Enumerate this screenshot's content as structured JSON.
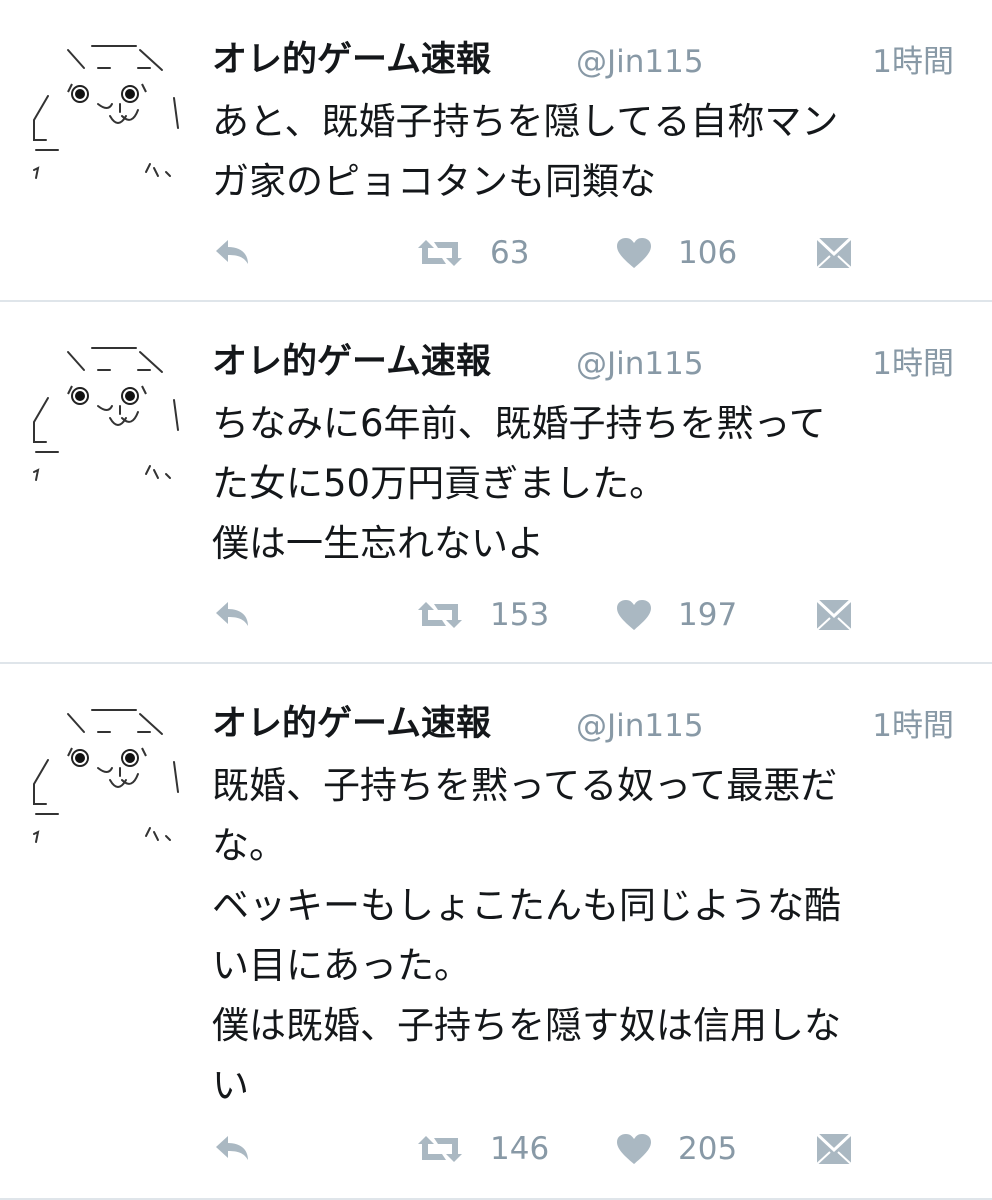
{
  "colors": {
    "text": "#14171a",
    "secondary": "#8899a6",
    "icon": "#aab8c2",
    "divider": "#dfe5ea"
  },
  "tweets": [
    {
      "display_name": "オレ的ゲーム速報",
      "handle": "@Jin115",
      "time": "1時間",
      "lines": [
        "あと、既婚子持ちを隠してる自称マン",
        "ガ家のピョコタンも同類な"
      ],
      "retweets": "63",
      "likes": "106",
      "icons": [
        "reply-icon",
        "retweet-icon",
        "heart-icon",
        "envelope-icon"
      ]
    },
    {
      "display_name": "オレ的ゲーム速報",
      "handle": "@Jin115",
      "time": "1時間",
      "lines": [
        "ちなみに6年前、既婚子持ちを黙って",
        "た女に50万円貢ぎました。",
        "僕は一生忘れないよ"
      ],
      "retweets": "153",
      "likes": "197",
      "icons": [
        "reply-icon",
        "retweet-icon",
        "heart-icon",
        "envelope-icon"
      ]
    },
    {
      "display_name": "オレ的ゲーム速報",
      "handle": "@Jin115",
      "time": "1時間",
      "lines": [
        "既婚、子持ちを黙ってる奴って最悪だ",
        "な。",
        "ベッキーもしょこたんも同じような酷",
        "い目にあった。",
        "僕は既婚、子持ちを隠す奴は信用しな",
        "い"
      ],
      "retweets": "146",
      "likes": "205",
      "icons": [
        "reply-icon",
        "retweet-icon",
        "heart-icon",
        "envelope-icon"
      ]
    }
  ]
}
